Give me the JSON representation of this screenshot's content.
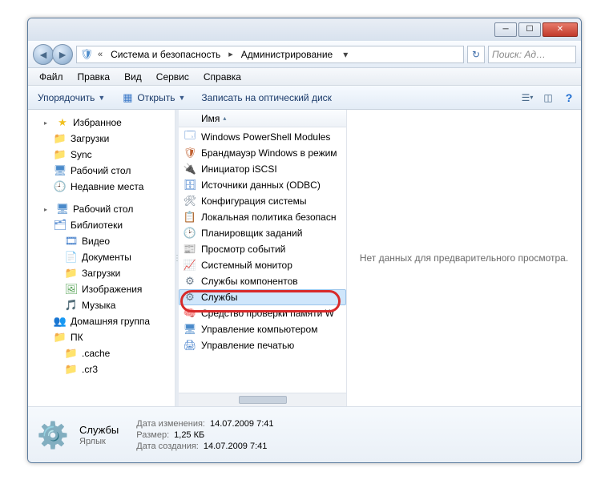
{
  "breadcrumb": {
    "seg1": "Система и безопасность",
    "seg2": "Администрирование"
  },
  "search": {
    "placeholder": "Поиск: Ад…"
  },
  "menu": {
    "file": "Файл",
    "edit": "Правка",
    "view": "Вид",
    "tools": "Сервис",
    "help": "Справка"
  },
  "toolbar": {
    "organize": "Упорядочить",
    "open": "Открыть",
    "burn": "Записать на оптический диск"
  },
  "nav": {
    "favorites": "Избранное",
    "downloads": "Загрузки",
    "sync": "Sync",
    "desktop_fav": "Рабочий стол",
    "recent": "Недавние места",
    "desktop_root": "Рабочий стол",
    "libraries": "Библиотеки",
    "videos": "Видео",
    "documents": "Документы",
    "downloads2": "Загрузки",
    "pictures": "Изображения",
    "music": "Музыка",
    "homegroup": "Домашняя группа",
    "pc": "ПК",
    "cache": ".cache",
    "cr3": ".cr3"
  },
  "list": {
    "header_name": "Имя",
    "items": [
      "Windows PowerShell Modules",
      "Брандмауэр Windows в режим",
      "Инициатор iSCSI",
      "Источники данных (ODBC)",
      "Конфигурация системы",
      "Локальная политика безопасн",
      "Планировщик заданий",
      "Просмотр событий",
      "Системный монитор",
      "Службы компонентов",
      "Службы",
      "Средство проверки памяти W",
      "Управление компьютером",
      "Управление печатью"
    ]
  },
  "preview": {
    "empty": "Нет данных для предварительного просмотра."
  },
  "details": {
    "name": "Службы",
    "type": "Ярлык",
    "modified_label": "Дата изменения:",
    "modified": "14.07.2009 7:41",
    "size_label": "Размер:",
    "size": "1,25 КБ",
    "created_label": "Дата создания:",
    "created": "14.07.2009 7:41"
  }
}
